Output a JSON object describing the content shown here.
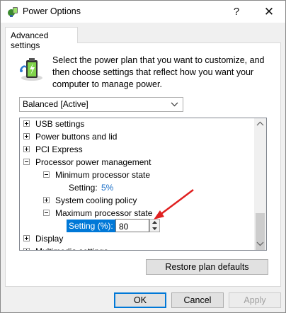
{
  "window": {
    "title": "Power Options",
    "help_glyph": "?",
    "close_glyph": "✕",
    "app_icon": "power-options-icon"
  },
  "tab": {
    "label": "Advanced settings"
  },
  "description": "Select the power plan that you want to customize, and then choose settings that reflect how you want your computer to manage power.",
  "plan_select": {
    "value": "Balanced [Active]"
  },
  "tree": {
    "usb": "USB settings",
    "power_buttons": "Power buttons and lid",
    "pci": "PCI Express",
    "processor": "Processor power management",
    "min_state": "Minimum processor state",
    "min_setting_label": "Setting:",
    "min_setting_value": "5%",
    "cooling": "System cooling policy",
    "max_state": "Maximum processor state",
    "max_setting_label": "Setting (%):",
    "max_setting_value": "80",
    "display": "Display",
    "multimedia": "Multimedia settings"
  },
  "buttons": {
    "restore": "Restore plan defaults",
    "ok": "OK",
    "cancel": "Cancel",
    "apply": "Apply"
  },
  "colors": {
    "selection": "#0078d7",
    "setting_value": "#1b6fc7",
    "annotation": "#e02020"
  }
}
